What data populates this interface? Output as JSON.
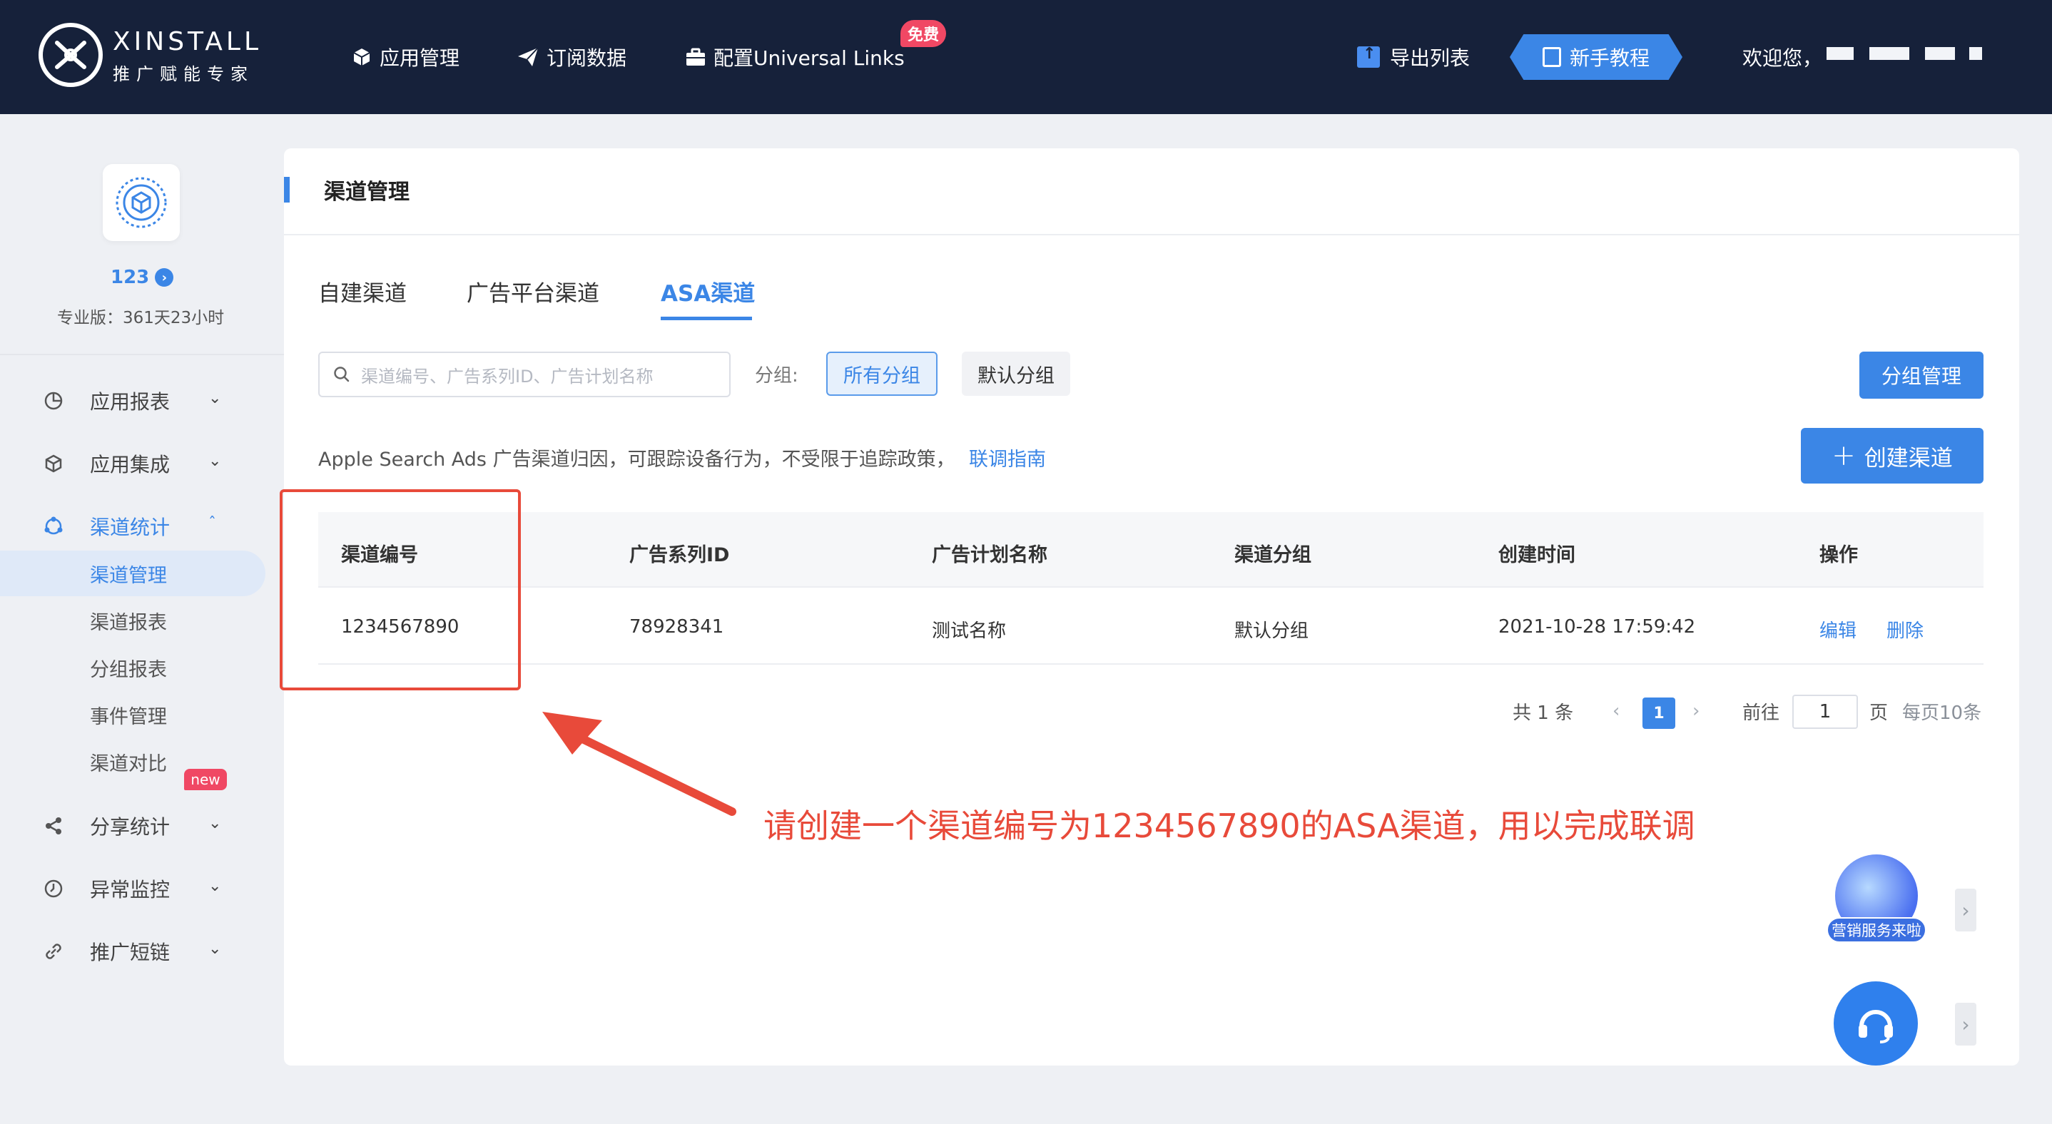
{
  "header": {
    "brand_name": "XINSTALL",
    "brand_sub": "推广赋能专家",
    "nav": [
      {
        "label": "应用管理",
        "icon": "cube-icon"
      },
      {
        "label": "订阅数据",
        "icon": "paper-plane-icon"
      },
      {
        "label": "配置Universal Links",
        "icon": "briefcase-icon"
      }
    ],
    "free_badge": "免费",
    "export_label": "导出列表",
    "tutorial_label": "新手教程",
    "welcome": "欢迎您，"
  },
  "sidebar": {
    "app_name": "123",
    "app_plan": "专业版：361天23小时",
    "menu": [
      {
        "label": "应用报表",
        "icon": "pie-chart-icon"
      },
      {
        "label": "应用集成",
        "icon": "box-icon"
      },
      {
        "label": "渠道统计",
        "icon": "cycle-icon"
      },
      {
        "label": "分享统计",
        "icon": "share-icon"
      },
      {
        "label": "异常监控",
        "icon": "clock-icon"
      },
      {
        "label": "推广短链",
        "icon": "link-icon"
      }
    ],
    "sub_items": [
      "渠道管理",
      "渠道报表",
      "分组报表",
      "事件管理",
      "渠道对比"
    ],
    "new_badge": "new"
  },
  "main": {
    "title": "渠道管理",
    "tabs": [
      "自建渠道",
      "广告平台渠道",
      "ASA渠道"
    ],
    "active_tab": "ASA渠道",
    "search_placeholder": "渠道编号、广告系列ID、广告计划名称",
    "group_label": "分组:",
    "group_chips": [
      "所有分组",
      "默认分组"
    ],
    "group_mgmt_button": "分组管理",
    "description": "Apple Search Ads 广告渠道归因，可跟踪设备行为，不受限于追踪政策，",
    "description_link": "联调指南",
    "create_button": "创建渠道",
    "table": {
      "columns": [
        "渠道编号",
        "广告系列ID",
        "广告计划名称",
        "渠道分组",
        "创建时间",
        "操作"
      ],
      "rows": [
        {
          "channel_id": "1234567890",
          "campaign_id": "78928341",
          "plan_name": "测试名称",
          "group": "默认分组",
          "created": "2021-10-28 17:59:42",
          "actions": [
            "编辑",
            "删除"
          ]
        }
      ]
    },
    "pagination": {
      "total": "共 1 条",
      "current_page": "1",
      "goto_label": "前往",
      "goto_value": "1",
      "page_suffix": "页",
      "per_page": "每页10条"
    }
  },
  "annotation": {
    "text": "请创建一个渠道编号为1234567890的ASA渠道，用以完成联调",
    "color": "#e84a3a"
  },
  "floating": {
    "marketing_label": "营销服务来啦"
  },
  "colors": {
    "accent": "#3b86e6",
    "topbar": "#16213a",
    "badge": "#f04864"
  }
}
